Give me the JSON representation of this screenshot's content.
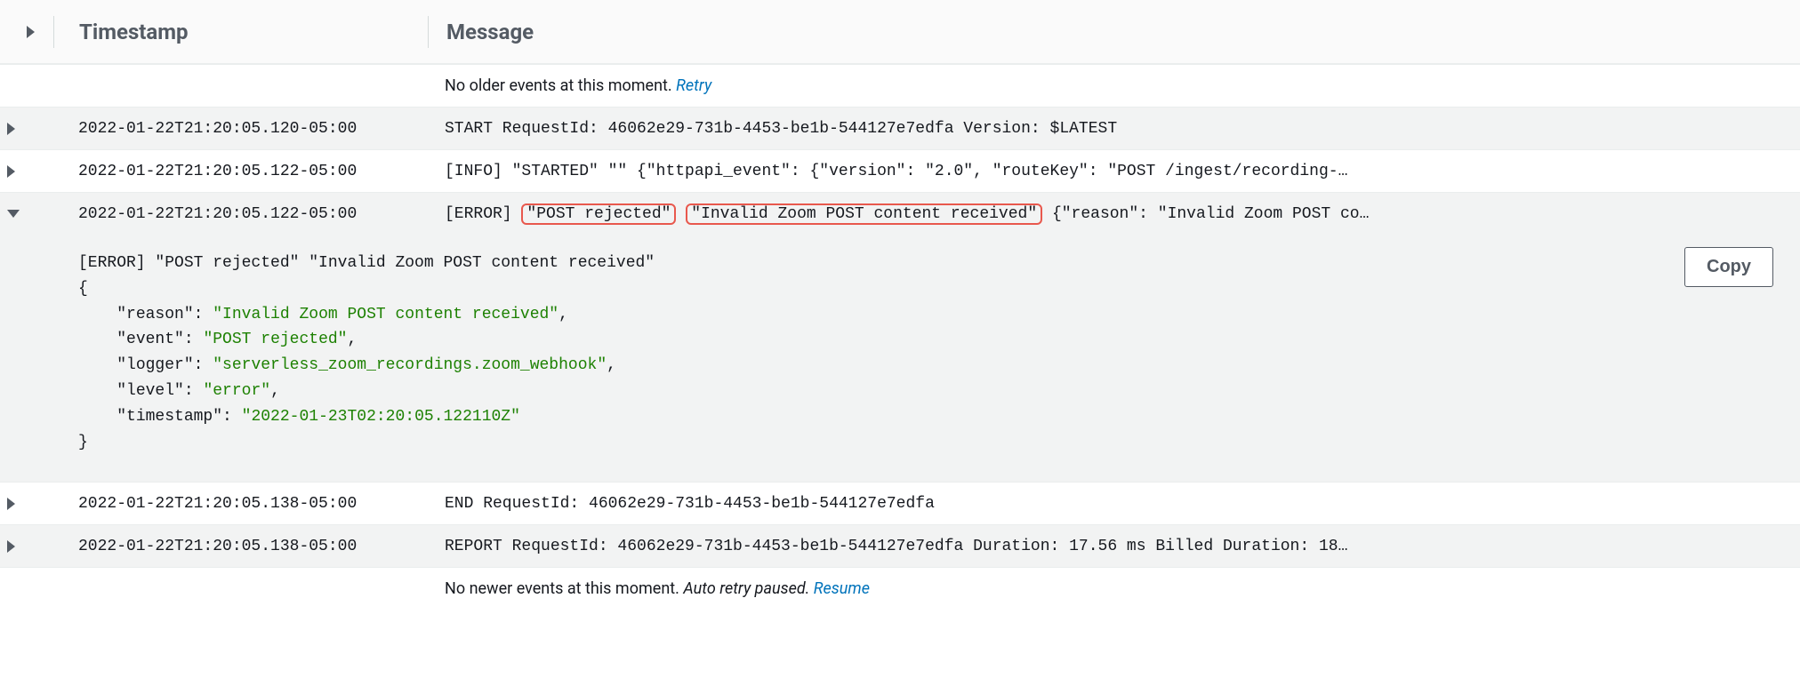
{
  "headers": {
    "timestamp": "Timestamp",
    "message": "Message"
  },
  "noOlder": {
    "text": "No older events at this moment. ",
    "retry": "Retry"
  },
  "noNewer": {
    "text": "No newer events at this moment. ",
    "paused": "Auto retry paused.",
    "resume": "Resume"
  },
  "copyLabel": "Copy",
  "rows": {
    "r0": {
      "ts": "2022-01-22T21:20:05.120-05:00",
      "msg": "START RequestId: 46062e29-731b-4453-be1b-544127e7edfa Version: $LATEST"
    },
    "r1": {
      "ts": "2022-01-22T21:20:05.122-05:00",
      "msg": "[INFO] \"STARTED\" \"\" {\"httpapi_event\": {\"version\": \"2.0\", \"routeKey\": \"POST /ingest/recording-…"
    },
    "r2": {
      "ts": "2022-01-22T21:20:05.122-05:00",
      "prefix": "[ERROR] ",
      "hl1": "\"POST rejected\"",
      "hl2": "\"Invalid Zoom POST content received\"",
      "suffix": " {\"reason\": \"Invalid Zoom POST co…"
    },
    "r3": {
      "ts": "2022-01-22T21:20:05.138-05:00",
      "msg": "END RequestId: 46062e29-731b-4453-be1b-544127e7edfa"
    },
    "r4": {
      "ts": "2022-01-22T21:20:05.138-05:00",
      "msg": "REPORT RequestId: 46062e29-731b-4453-be1b-544127e7edfa Duration: 17.56 ms Billed Duration: 18…"
    }
  },
  "expanded": {
    "line1": "[ERROR] \"POST rejected\" \"Invalid Zoom POST content received\"",
    "open": "{",
    "k_reason": "\"reason\"",
    "v_reason": "\"Invalid Zoom POST content received\"",
    "k_event": "\"event\"",
    "v_event": "\"POST rejected\"",
    "k_logger": "\"logger\"",
    "v_logger": "\"serverless_zoom_recordings.zoom_webhook\"",
    "k_level": "\"level\"",
    "v_level": "\"error\"",
    "k_timestamp": "\"timestamp\"",
    "v_timestamp": "\"2022-01-23T02:20:05.122110Z\"",
    "close": "}"
  }
}
